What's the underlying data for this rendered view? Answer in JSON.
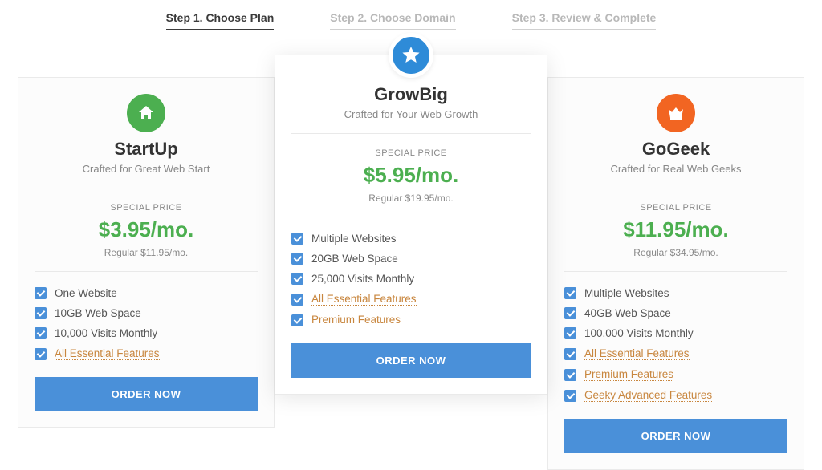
{
  "steps": [
    {
      "label": "Step 1. Choose Plan",
      "active": true
    },
    {
      "label": "Step 2. Choose Domain",
      "active": false
    },
    {
      "label": "Step 3. Review & Complete",
      "active": false
    }
  ],
  "plans": [
    {
      "id": "startup",
      "name": "StartUp",
      "tagline": "Crafted for Great Web Start",
      "icon": "home",
      "icon_bg": "#4caf50",
      "featured": false,
      "price_label": "SPECIAL PRICE",
      "price": "$3.95/mo.",
      "regular": "Regular $11.95/mo.",
      "features": [
        {
          "text": "One Website",
          "link": false
        },
        {
          "text": "10GB Web Space",
          "link": false
        },
        {
          "text": "10,000 Visits Monthly",
          "link": false
        },
        {
          "text": "All Essential Features",
          "link": true
        }
      ],
      "order": "ORDER NOW"
    },
    {
      "id": "growbig",
      "name": "GrowBig",
      "tagline": "Crafted for Your Web Growth",
      "icon": "star",
      "icon_bg": "#2e8bd8",
      "featured": true,
      "price_label": "SPECIAL PRICE",
      "price": "$5.95/mo.",
      "regular": "Regular $19.95/mo.",
      "features": [
        {
          "text": "Multiple Websites",
          "link": false
        },
        {
          "text": "20GB Web Space",
          "link": false
        },
        {
          "text": "25,000 Visits Monthly",
          "link": false
        },
        {
          "text": "All Essential Features",
          "link": true
        },
        {
          "text": "Premium Features",
          "link": true
        }
      ],
      "order": "ORDER NOW"
    },
    {
      "id": "gogeek",
      "name": "GoGeek",
      "tagline": "Crafted for Real Web Geeks",
      "icon": "crown",
      "icon_bg": "#f26522",
      "featured": false,
      "price_label": "SPECIAL PRICE",
      "price": "$11.95/mo.",
      "regular": "Regular $34.95/mo.",
      "features": [
        {
          "text": "Multiple Websites",
          "link": false
        },
        {
          "text": "40GB Web Space",
          "link": false
        },
        {
          "text": "100,000 Visits Monthly",
          "link": false
        },
        {
          "text": "All Essential Features",
          "link": true
        },
        {
          "text": "Premium Features",
          "link": true
        },
        {
          "text": "Geeky Advanced Features",
          "link": true
        }
      ],
      "order": "ORDER NOW"
    }
  ]
}
